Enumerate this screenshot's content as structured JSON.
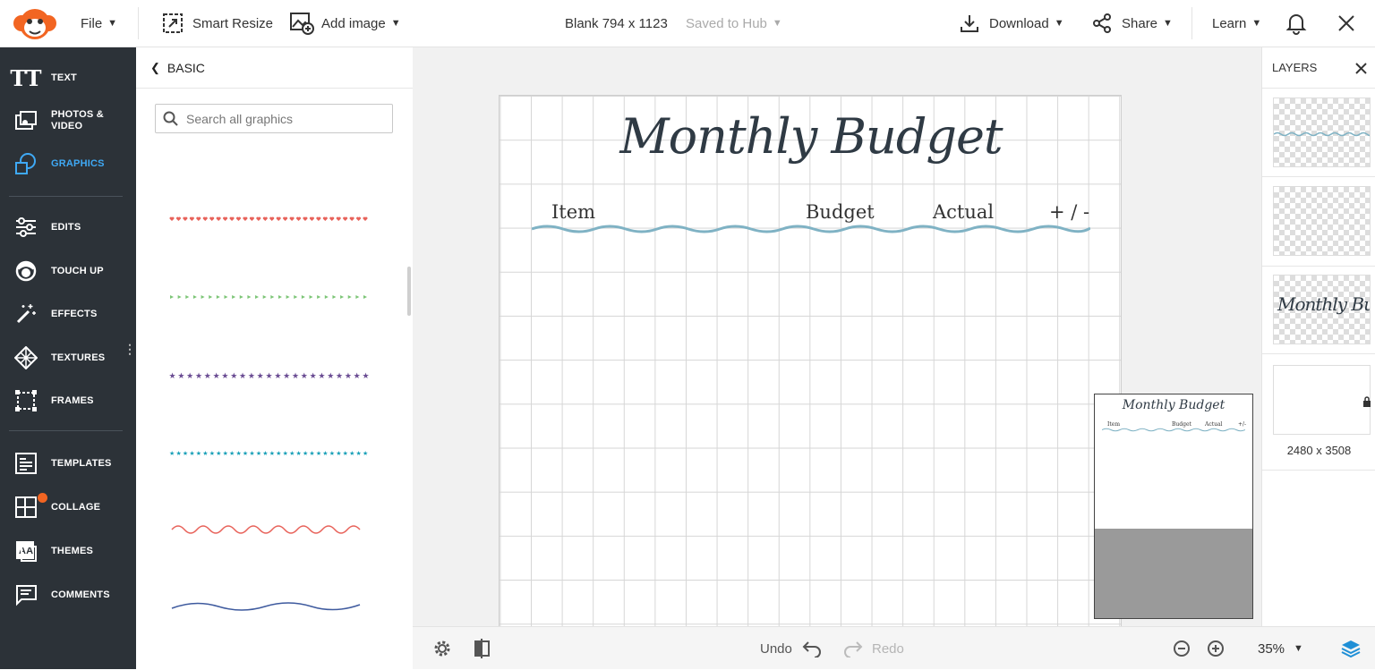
{
  "topbar": {
    "file_label": "File",
    "smart_resize_label": "Smart Resize",
    "add_image_label": "Add image",
    "doc_title": "Blank 794 x 1123",
    "save_status": "Saved to Hub",
    "download_label": "Download",
    "share_label": "Share",
    "learn_label": "Learn"
  },
  "nav": {
    "items": [
      {
        "label": "TEXT",
        "icon": "text-icon"
      },
      {
        "label": "PHOTOS & VIDEO",
        "icon": "photos-video-icon"
      },
      {
        "label": "GRAPHICS",
        "icon": "graphics-icon",
        "active": true
      },
      {
        "label": "EDITS",
        "icon": "sliders-icon"
      },
      {
        "label": "TOUCH UP",
        "icon": "face-icon"
      },
      {
        "label": "EFFECTS",
        "icon": "magic-wand-icon"
      },
      {
        "label": "TEXTURES",
        "icon": "texture-icon"
      },
      {
        "label": "FRAMES",
        "icon": "frame-icon"
      },
      {
        "label": "TEMPLATES",
        "icon": "template-icon"
      },
      {
        "label": "COLLAGE",
        "icon": "collage-icon"
      },
      {
        "label": "THEMES",
        "icon": "themes-icon"
      },
      {
        "label": "COMMENTS",
        "icon": "comments-icon"
      }
    ],
    "active_color": "#3fa9f5",
    "collage_badge_color": "#f26522"
  },
  "panel": {
    "back_label": "BASIC",
    "search_placeholder": "Search all graphics",
    "graphics": [
      "red-hearts-divider",
      "green-arrows-divider",
      "purple-stars-divider",
      "teal-stars-divider",
      "red-wave-divider",
      "blue-wave-divider"
    ]
  },
  "canvas": {
    "title": "Monthly Budget",
    "headers": [
      "Item",
      "Budget",
      "Actual",
      "+ / -"
    ],
    "wave_color": "#7fb2c4"
  },
  "minimap": {
    "title": "Monthly Budget",
    "headers": [
      "Item",
      "Budget",
      "Actual",
      "+/-"
    ]
  },
  "bottombar": {
    "undo_label": "Undo",
    "redo_label": "Redo",
    "zoom": "35%"
  },
  "layers": {
    "title": "LAYERS",
    "thumb_text": "Monthly Bu",
    "background_size": "2480 x 3508"
  }
}
